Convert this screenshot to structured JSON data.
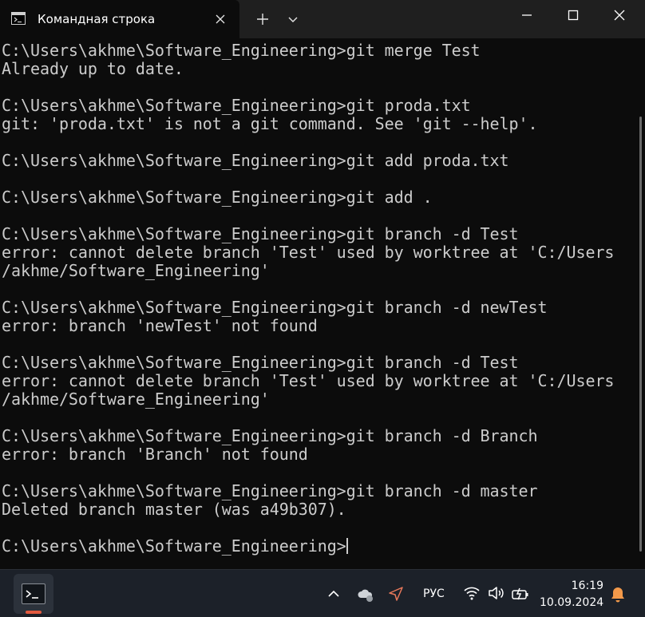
{
  "window": {
    "tab_title": "Командная строка",
    "icons": {
      "tab": "console-icon",
      "tab_close": "close-icon",
      "new_tab": "plus-icon",
      "dropdown": "chevron-down-icon",
      "minimize": "minimize-icon",
      "maximize": "maximize-icon",
      "close": "close-icon"
    }
  },
  "console": {
    "lines": [
      "C:\\Users\\akhme\\Software_Engineering>git merge Test",
      "Already up to date.",
      "",
      "C:\\Users\\akhme\\Software_Engineering>git proda.txt",
      "git: 'proda.txt' is not a git command. See 'git --help'.",
      "",
      "C:\\Users\\akhme\\Software_Engineering>git add proda.txt",
      "",
      "C:\\Users\\akhme\\Software_Engineering>git add .",
      "",
      "C:\\Users\\akhme\\Software_Engineering>git branch -d Test",
      "error: cannot delete branch 'Test' used by worktree at 'C:/Users",
      "/akhme/Software_Engineering'",
      "",
      "C:\\Users\\akhme\\Software_Engineering>git branch -d newTest",
      "error: branch 'newTest' not found",
      "",
      "C:\\Users\\akhme\\Software_Engineering>git branch -d Test",
      "error: cannot delete branch 'Test' used by worktree at 'C:/Users",
      "/akhme/Software_Engineering'",
      "",
      "C:\\Users\\akhme\\Software_Engineering>git branch -d Branch",
      "error: branch 'Branch' not found",
      "",
      "C:\\Users\\akhme\\Software_Engineering>git branch -d master",
      "Deleted branch master (was a49b307).",
      ""
    ],
    "prompt": "C:\\Users\\akhme\\Software_Engineering>"
  },
  "taskbar": {
    "language": "РУС",
    "time": "16:19",
    "date": "10.09.2024",
    "colors": {
      "background": "#1c2129",
      "active_indicator": "#e25a3f",
      "bell": "#f2994a"
    }
  }
}
